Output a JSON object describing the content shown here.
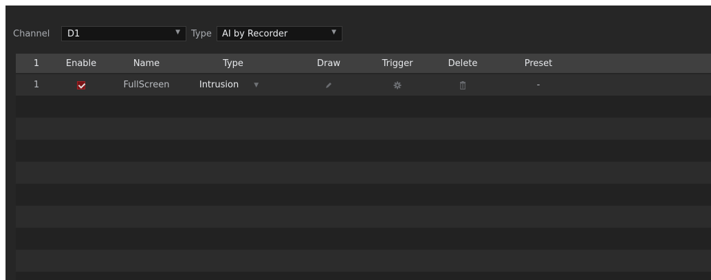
{
  "filters": {
    "channel_label": "Channel",
    "channel_value": "D1",
    "type_label": "Type",
    "type_value": "AI by Recorder"
  },
  "table": {
    "columns": [
      "1",
      "Enable",
      "Name",
      "Type",
      "Draw",
      "Trigger",
      "Delete",
      "Preset"
    ],
    "rows": [
      {
        "index": "1",
        "enabled": true,
        "name": "FullScreen",
        "type": "Intrusion",
        "preset": "-"
      }
    ]
  },
  "icons": {
    "dropdown": "chevron-down-icon",
    "draw": "pencil-icon",
    "trigger": "gear-icon",
    "delete": "trash-icon"
  },
  "colors": {
    "checkbox_accent": "#a02226",
    "panel_bg": "#262626",
    "header_bg": "#404040"
  }
}
